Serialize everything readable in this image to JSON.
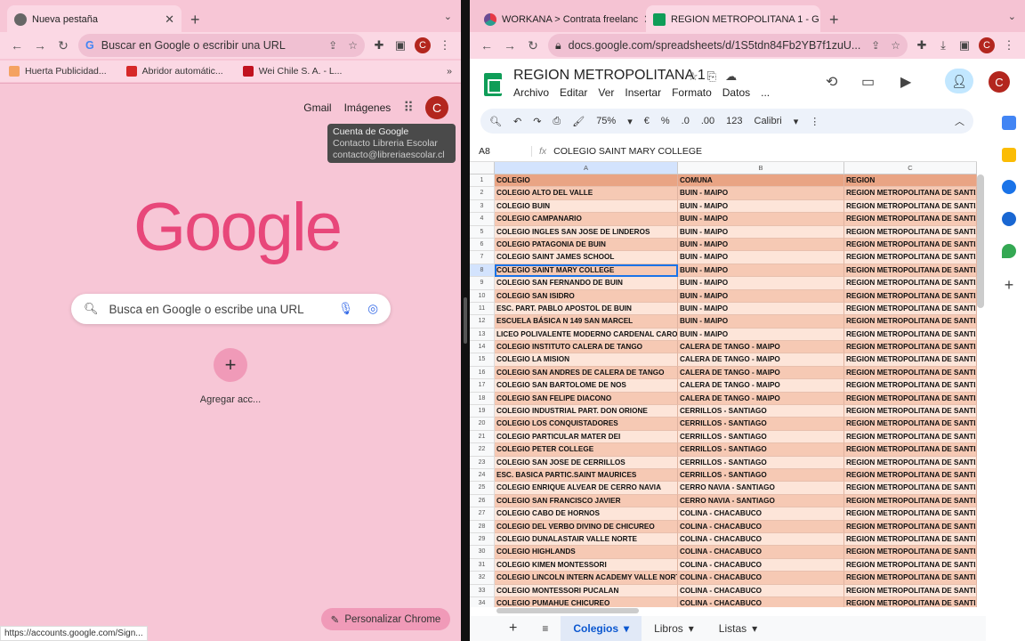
{
  "left": {
    "tab_title": "Nueva pestaña",
    "address_placeholder": "Buscar en Google o escribir una URL",
    "avatar_letter": "C",
    "bookmarks": [
      "Huerta Publicidad...",
      "Abridor automátic...",
      "Wei Chile S. A. - L..."
    ],
    "header_links": {
      "gmail": "Gmail",
      "images": "Imágenes"
    },
    "tooltip": {
      "title": "Cuenta de Google",
      "name": "Contacto Libreria Escolar",
      "email": "contacto@libreriaescolar.cl"
    },
    "logo_text": "Google",
    "search_placeholder": "Busca en Google o escribe una URL",
    "shortcut_label": "Agregar acc...",
    "customize_label": "Personalizar Chrome",
    "status_url": "https://accounts.google.com/Sign..."
  },
  "right": {
    "tabs": [
      "WORKANA > Contrata freelanc",
      "REGION METROPOLITANA 1 - G"
    ],
    "url": "docs.google.com/spreadsheets/d/1S5tdn84Fb2YB7f1zuU...",
    "doc_title": "REGION METROPOLITANA 1",
    "menus": [
      "Archivo",
      "Editar",
      "Ver",
      "Insertar",
      "Formato",
      "Datos",
      "..."
    ],
    "zoom": "75%",
    "font": "Calibri",
    "cell_ref": "A8",
    "formula": "COLEGIO SAINT MARY COLLEGE",
    "columns": [
      "A",
      "B",
      "C"
    ],
    "header_row": [
      "COLEGIO",
      "COMUNA",
      "REGION"
    ],
    "rows": [
      [
        "COLEGIO ALTO DEL VALLE",
        "BUIN - MAIPO"
      ],
      [
        "COLEGIO BUIN",
        "BUIN - MAIPO"
      ],
      [
        "COLEGIO CAMPANARIO",
        "BUIN - MAIPO"
      ],
      [
        "COLEGIO INGLES SAN JOSE DE LINDEROS",
        "BUIN - MAIPO"
      ],
      [
        "COLEGIO PATAGONIA DE BUIN",
        "BUIN - MAIPO"
      ],
      [
        "COLEGIO SAINT JAMES SCHOOL",
        "BUIN - MAIPO"
      ],
      [
        "COLEGIO SAINT MARY COLLEGE",
        "BUIN - MAIPO"
      ],
      [
        "COLEGIO SAN FERNANDO DE BUIN",
        "BUIN - MAIPO"
      ],
      [
        "COLEGIO SAN ISIDRO",
        "BUIN - MAIPO"
      ],
      [
        "ESC. PART. PABLO APOSTOL DE BUIN",
        "BUIN - MAIPO"
      ],
      [
        "ESCUELA BÁSICA N 149 SAN MARCEL",
        "BUIN - MAIPO"
      ],
      [
        "LICEO POLIVALENTE MODERNO CARDENAL CARO",
        "BUIN - MAIPO"
      ],
      [
        "COLEGIO INSTITUTO CALERA DE TANGO",
        "CALERA DE TANGO - MAIPO"
      ],
      [
        "COLEGIO LA MISION",
        "CALERA DE TANGO - MAIPO"
      ],
      [
        "COLEGIO SAN ANDRES DE CALERA DE TANGO",
        "CALERA DE TANGO - MAIPO"
      ],
      [
        "COLEGIO SAN BARTOLOME DE NOS",
        "CALERA DE TANGO - MAIPO"
      ],
      [
        "COLEGIO SAN FELIPE DIACONO",
        "CALERA DE TANGO - MAIPO"
      ],
      [
        "COLEGIO INDUSTRIAL PART. DON ORIONE",
        "CERRILLOS - SANTIAGO"
      ],
      [
        "COLEGIO LOS CONQUISTADORES",
        "CERRILLOS - SANTIAGO"
      ],
      [
        "COLEGIO PARTICULAR MATER DEI",
        "CERRILLOS - SANTIAGO"
      ],
      [
        "COLEGIO PETER COLLEGE",
        "CERRILLOS - SANTIAGO"
      ],
      [
        "COLEGIO SAN JOSE DE CERRILLOS",
        "CERRILLOS - SANTIAGO"
      ],
      [
        "ESC. BASICA PARTIC.SAINT MAURICES",
        "CERRILLOS - SANTIAGO"
      ],
      [
        "COLEGIO ENRIQUE ALVEAR DE CERRO NAVIA",
        "CERRO NAVIA - SANTIAGO"
      ],
      [
        "COLEGIO SAN FRANCISCO JAVIER",
        "CERRO NAVIA - SANTIAGO"
      ],
      [
        "COLEGIO CABO DE HORNOS",
        "COLINA - CHACABUCO"
      ],
      [
        "COLEGIO DEL VERBO DIVINO DE CHICUREO",
        "COLINA - CHACABUCO"
      ],
      [
        "COLEGIO DUNALASTAIR VALLE NORTE",
        "COLINA - CHACABUCO"
      ],
      [
        "COLEGIO HIGHLANDS",
        "COLINA - CHACABUCO"
      ],
      [
        "COLEGIO KIMEN MONTESSORI",
        "COLINA - CHACABUCO"
      ],
      [
        "COLEGIO LINCOLN INTERN ACADEMY VALLE NORTE C",
        "COLINA - CHACABUCO"
      ],
      [
        "COLEGIO MONTESSORI PUCALAN",
        "COLINA - CHACABUCO"
      ],
      [
        "COLEGIO PUMAHUE CHICUREO",
        "COLINA - CHACABUCO"
      ]
    ],
    "region_value": "REGION METROPOLITANA DE SANTIAGO",
    "sheet_tabs": [
      "Colegios",
      "Libros",
      "Listas"
    ]
  }
}
